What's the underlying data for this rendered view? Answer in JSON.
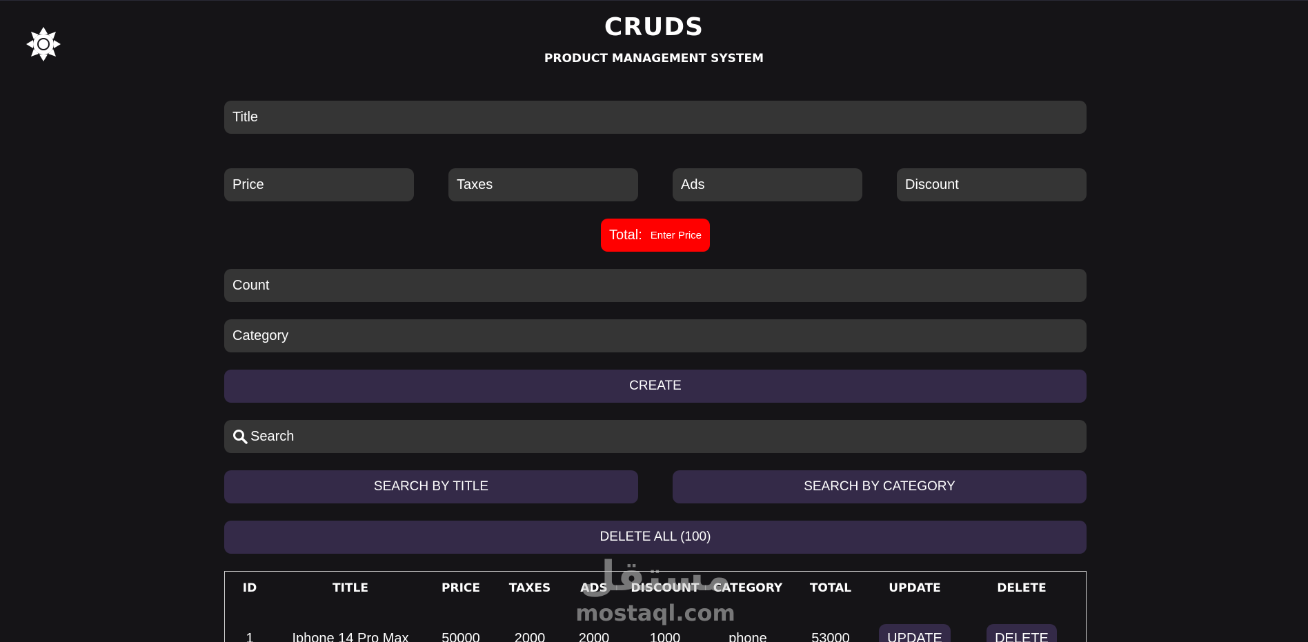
{
  "header": {
    "title": "CRUDS",
    "subtitle": "PRODUCT MANAGEMENT SYSTEM",
    "theme_icon": "sun-icon"
  },
  "form": {
    "title_placeholder": "Title",
    "price_placeholder": "Price",
    "taxes_placeholder": "Taxes",
    "ads_placeholder": "Ads",
    "discount_placeholder": "Discount",
    "total_label": "Total:",
    "total_value": "Enter Price",
    "count_placeholder": "Count",
    "category_placeholder": "Category",
    "create_label": "CREATE"
  },
  "search": {
    "placeholder": "Search",
    "icon": "search-icon",
    "by_title_label": "SEARCH BY TITLE",
    "by_category_label": "SEARCH BY CATEGORY"
  },
  "delete_all_label": "DELETE ALL (100)",
  "table": {
    "headers": [
      "ID",
      "TITLE",
      "PRICE",
      "TAXES",
      "ADS",
      "DISCOUNT",
      "CATEGORY",
      "TOTAL",
      "UPDATE",
      "DELETE"
    ],
    "rows": [
      {
        "id": "1",
        "title": "Iphone 14 Pro Max",
        "price": "50000",
        "taxes": "2000",
        "ads": "2000",
        "discount": "1000",
        "category": "phone",
        "total": "53000",
        "update_label": "UPDATE",
        "delete_label": "DELETE"
      }
    ]
  },
  "watermark": {
    "arabic": "مستقل",
    "latin": "mostaql.com"
  },
  "colors": {
    "background": "#151417",
    "input": "#353535",
    "button": "#342a48",
    "total_box": "#ff0000"
  }
}
